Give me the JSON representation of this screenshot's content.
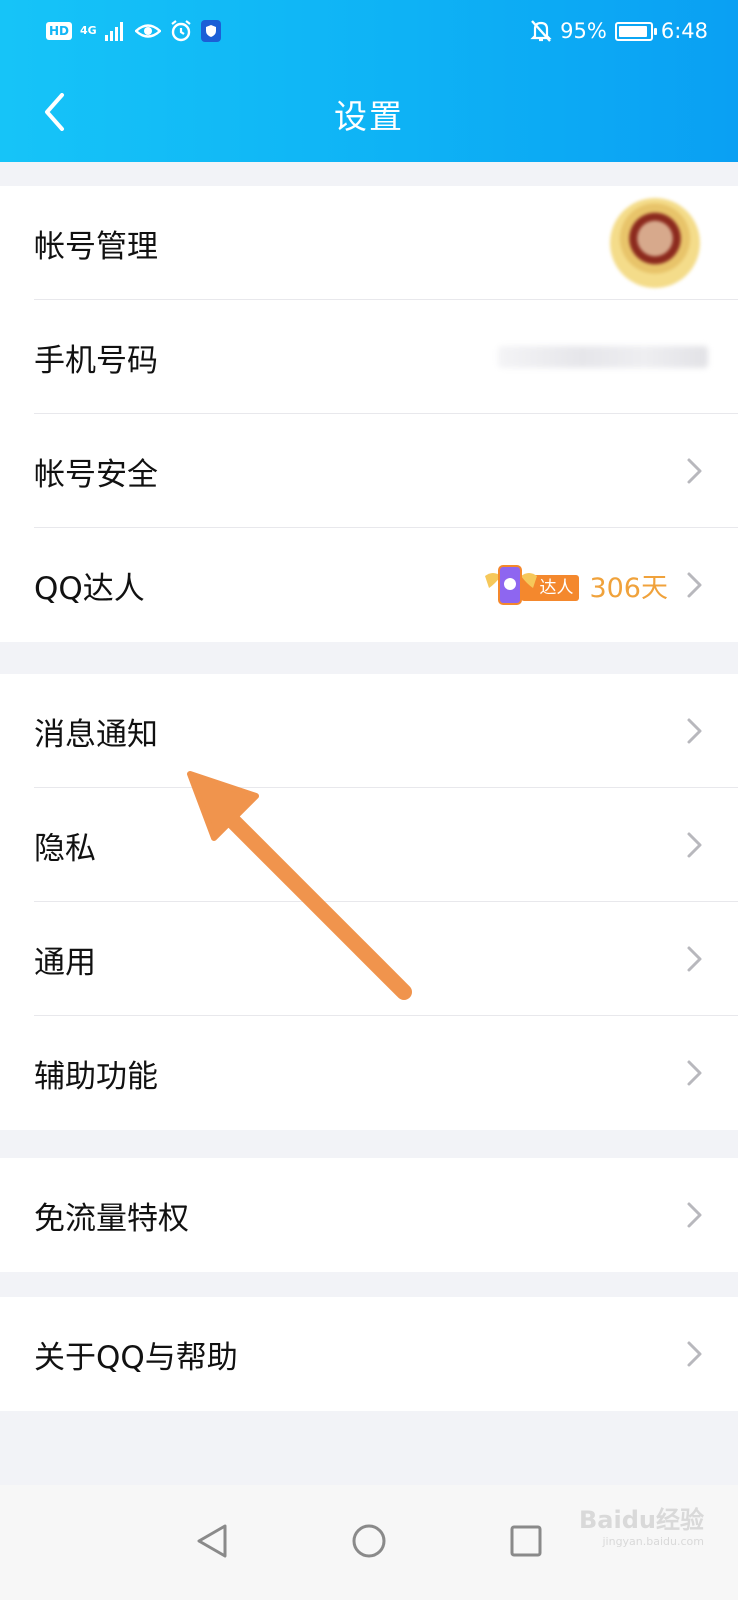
{
  "status_bar": {
    "hd": "HD",
    "network": "4G",
    "battery_percent": "95%",
    "battery_level": 0.95,
    "time": "6:48",
    "icons": [
      "signal-icon",
      "eye-icon",
      "alarm-icon",
      "shield-icon",
      "mute-bell-icon",
      "battery-icon"
    ]
  },
  "header": {
    "title": "设置",
    "back_icon": "chevron-left-icon",
    "background_colors": [
      "#16c4f8",
      "#0aa0f3"
    ]
  },
  "groups": {
    "account": {
      "items": [
        {
          "label": "帐号管理"
        },
        {
          "label": "手机号码"
        },
        {
          "label": "帐号安全"
        },
        {
          "label": "QQ达人",
          "badge_text": "达人",
          "days": "306天"
        }
      ]
    },
    "settings": {
      "items": [
        {
          "label": "消息通知"
        },
        {
          "label": "隐私"
        },
        {
          "label": "通用"
        },
        {
          "label": "辅助功能"
        }
      ]
    },
    "privilege": {
      "items": [
        {
          "label": "免流量特权"
        }
      ]
    },
    "about": {
      "items": [
        {
          "label": "关于QQ与帮助"
        }
      ]
    }
  },
  "system_nav": {
    "icons": [
      "back-triangle-icon",
      "home-circle-icon",
      "recents-square-icon"
    ]
  },
  "watermark": {
    "brand": "Baidu经验",
    "url": "jingyan.baidu.com"
  },
  "colors": {
    "accent": "#0eb2f5",
    "days_text": "#f0a23b",
    "badge_orange": "#f4882d",
    "annotation_arrow": "#f0944d"
  }
}
